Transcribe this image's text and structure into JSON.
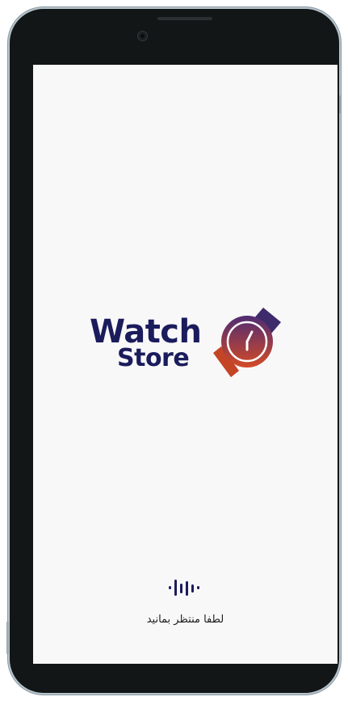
{
  "app": {
    "logo_line1": "Watch",
    "logo_line2": "Store",
    "logo_icon": "watch-icon"
  },
  "splash": {
    "loader_icon": "audio-wave-loader-icon",
    "loading_text": "لطفا منتظر بمانید"
  },
  "colors": {
    "brand_navy": "#1b1c5c",
    "brand_purple": "#5a2a6e",
    "brand_orange": "#d2482a",
    "screen_background": "#f9f8f9",
    "device_frame": "#121616"
  }
}
